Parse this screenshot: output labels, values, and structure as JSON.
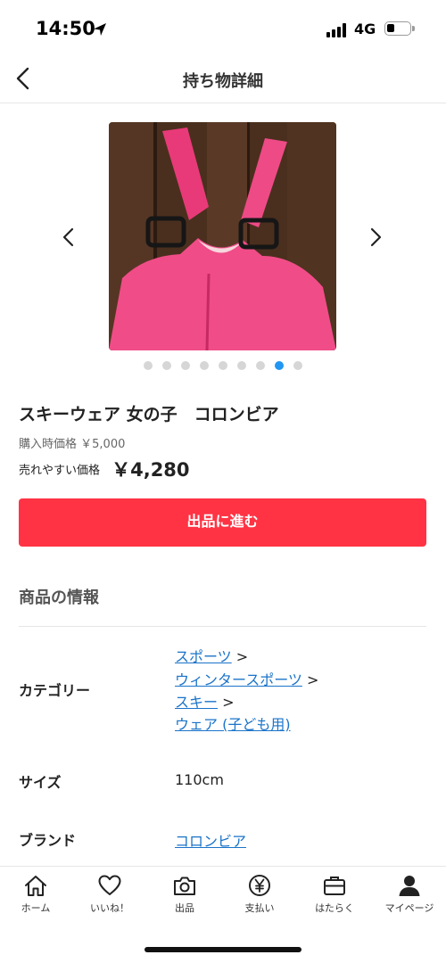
{
  "status_bar": {
    "time": "14:50",
    "network": "4G"
  },
  "header": {
    "title": "持ち物詳細"
  },
  "carousel": {
    "total_images": 9,
    "active_index": 7
  },
  "product": {
    "name": "スキーウェア 女の子　コロンビア",
    "purchase_price_label": "購入時価格",
    "purchase_price": "￥5,000",
    "sell_price_label": "売れやすい価格",
    "sell_price": "￥4,280"
  },
  "cta": {
    "label": "出品に進む",
    "color": "#ff3344"
  },
  "info_section": {
    "title": "商品の情報",
    "category_label": "カテゴリー",
    "categories": [
      "スポーツ",
      "ウィンタースポーツ",
      "スキー",
      "ウェア (子ども用)"
    ],
    "separator": ">",
    "size_label": "サイズ",
    "size_value": "110cm",
    "brand_label": "ブランド",
    "brand_value": "コロンビア"
  },
  "tab_bar": {
    "tabs": [
      {
        "label": "ホーム",
        "icon": "home-icon"
      },
      {
        "label": "いいね！",
        "icon": "heart-icon"
      },
      {
        "label": "出品",
        "icon": "camera-icon"
      },
      {
        "label": "支払い",
        "icon": "yen-icon"
      },
      {
        "label": "はたらく",
        "icon": "briefcase-icon"
      },
      {
        "label": "マイページ",
        "icon": "person-icon"
      }
    ]
  },
  "colors": {
    "link": "#1a73c9",
    "accent": "#ff3344",
    "active_dot": "#2196f3"
  }
}
